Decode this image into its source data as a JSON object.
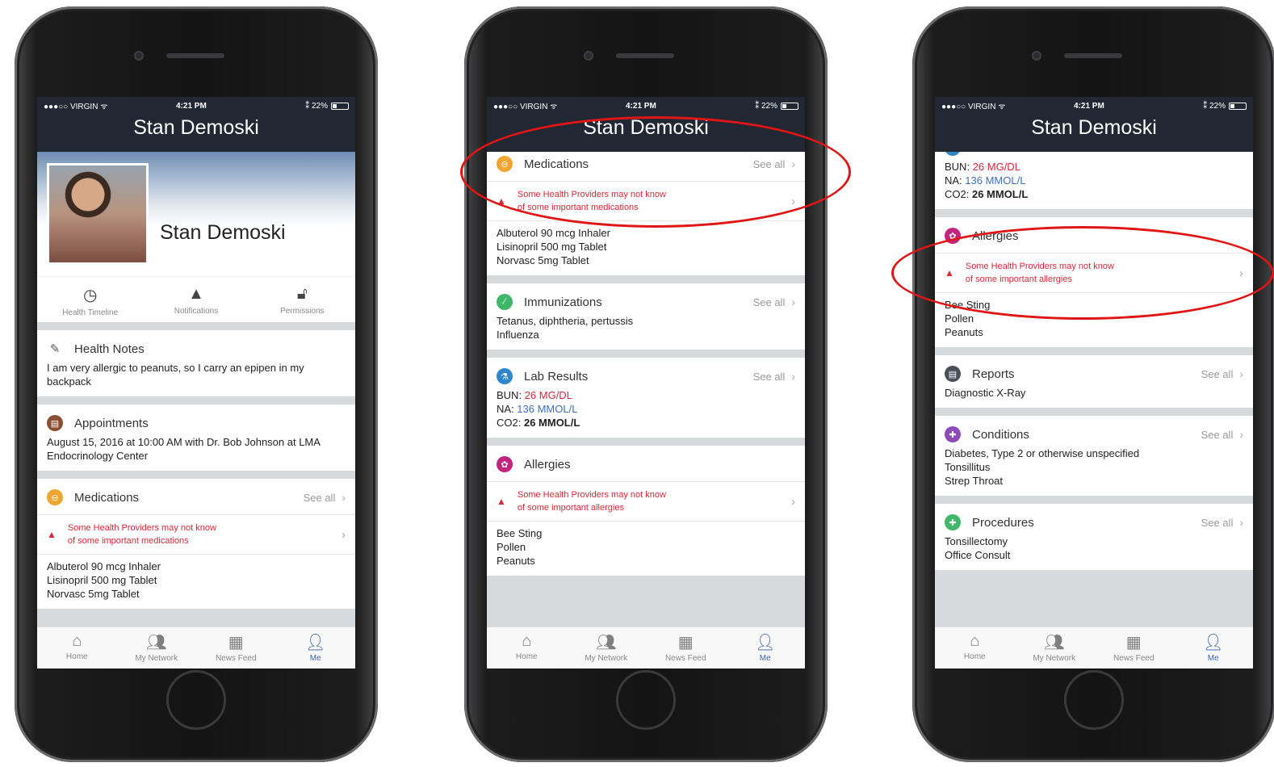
{
  "status": {
    "carrier": "●●●○○ VIRGIN ᯤ",
    "time": "4:21 PM",
    "battery": "⁑ 22%"
  },
  "header": {
    "title": "Stan Demoski"
  },
  "profile": {
    "name": "Stan Demoski",
    "links": [
      "Health Timeline",
      "Notifications",
      "Permissions"
    ]
  },
  "health_notes": {
    "title": "Health Notes",
    "text": "I am very allergic to peanuts, so I carry an epipen in my backpack"
  },
  "appointments": {
    "title": "Appointments",
    "text": "August 15, 2016 at 10:00 AM with Dr. Bob Johnson at LMA Endocrinology Center"
  },
  "medications": {
    "title": "Medications",
    "see_all": "See all",
    "warning": "Some Health Providers may not know\nof some important medications",
    "items": [
      "Albuterol 90 mcg Inhaler",
      "Lisinopril 500 mg Tablet",
      "Norvasc 5mg Tablet"
    ]
  },
  "immunizations": {
    "title": "Immunizations",
    "see_all": "See all",
    "items": [
      "Tetanus, diphtheria, pertussis",
      "Influenza"
    ]
  },
  "lab_results": {
    "title": "Lab Results",
    "see_all": "See all",
    "rows": [
      {
        "label": "BUN:",
        "value": "26 MG/DL"
      },
      {
        "label": "NA:",
        "value": "136 MMOL/L"
      },
      {
        "label": "CO2:",
        "value": "26 MMOL/L"
      }
    ]
  },
  "allergies": {
    "title": "Allergies",
    "warning": "Some Health Providers may not know\nof some important allergies",
    "items": [
      "Bee Sting",
      "Pollen",
      "Peanuts"
    ]
  },
  "reports": {
    "title": "Reports",
    "see_all": "See all",
    "items": [
      "Diagnostic X-Ray"
    ]
  },
  "conditions": {
    "title": "Conditions",
    "see_all": "See all",
    "items": [
      "Diabetes, Type 2 or otherwise unspecified",
      "Tonsillitus",
      "Strep Throat"
    ]
  },
  "procedures": {
    "title": "Procedures",
    "see_all": "See all",
    "items": [
      "Tonsillectomy",
      "Office Consult"
    ]
  },
  "tabs": [
    "Home",
    "My Network",
    "News Feed",
    "Me"
  ],
  "colors": {
    "accent": "#3b64a8",
    "alert": "#d8283a",
    "header_bg": "#222833",
    "annotation": "#e01515"
  },
  "icons": [
    "clock-icon",
    "warning-icon",
    "unlock-icon",
    "edit-icon",
    "home-icon",
    "network-icon",
    "newsfeed-icon",
    "user-icon"
  ]
}
